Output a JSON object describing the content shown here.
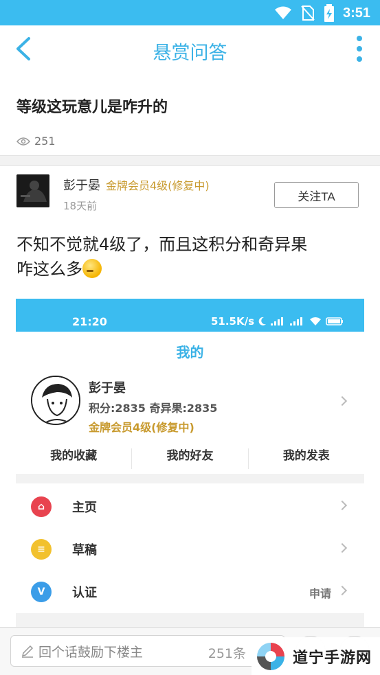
{
  "status_bar": {
    "time": "3:51",
    "icons": [
      "wifi-icon",
      "no-sim-icon",
      "battery-charging-icon"
    ]
  },
  "app_bar": {
    "title": "悬赏问答",
    "back_icon": "back-arrow-icon",
    "more_icon": "more-vert-icon"
  },
  "question": {
    "title": "等级这玩意儿是咋升的",
    "views": "251"
  },
  "post": {
    "author": "彭于晏",
    "badge": "金牌会员4级(修复中)",
    "time": "18天前",
    "follow_label": "关注TA",
    "text_line1": "不知不觉就4级了，而且这积分和奇异果",
    "text_line2": "咋这么多",
    "emoji": "thinking-face-emoji"
  },
  "embedded_screenshot": {
    "status_time": "21:20",
    "status_right": "51.5K/s",
    "page_title": "我的",
    "profile_name": "彭于晏",
    "profile_stats": "积分:2835  奇异果:2835",
    "profile_badge": "金牌会员4级(修复中)",
    "tabs": [
      "我的收藏",
      "我的好友",
      "我的发表"
    ],
    "menu": [
      {
        "label": "主页",
        "icon": "home-icon",
        "color": "#e8434f",
        "right": ""
      },
      {
        "label": "草稿",
        "icon": "draft-icon",
        "color": "#f2c12e",
        "right": ""
      },
      {
        "label": "认证",
        "icon": "verified-icon",
        "color": "#3b9de8",
        "right": "申请"
      }
    ]
  },
  "bottom_bar": {
    "placeholder": "回个话鼓励下楼主",
    "count": "251条"
  },
  "watermark": {
    "text": "道宁手游网"
  },
  "colors": {
    "accent": "#3bbcf0",
    "title_blue": "#3bb2e6",
    "gold": "#c89a2e"
  }
}
